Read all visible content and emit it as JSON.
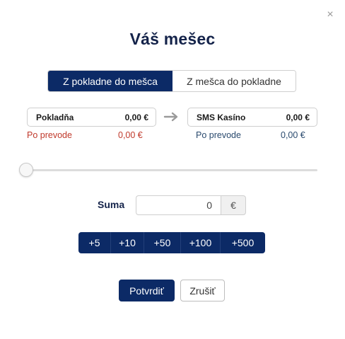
{
  "modal": {
    "title": "Váš mešec",
    "close_icon": "close-icon",
    "close_glyph": "×"
  },
  "tabs": [
    {
      "label": "Z pokladne do mešca",
      "active": true
    },
    {
      "label": "Z mešca do pokladne",
      "active": false
    }
  ],
  "source": {
    "name": "Pokladňa",
    "amount": "0,00 €",
    "after_label": "Po prevode",
    "after_amount": "0,00 €"
  },
  "target": {
    "name": "SMS Kasíno",
    "amount": "0,00 €",
    "after_label": "Po prevode",
    "after_amount": "0,00 €"
  },
  "arrow_icon": "arrow-right-icon",
  "slider": {
    "value_fraction": 0.0
  },
  "amount": {
    "label": "Suma",
    "value": "0",
    "currency": "€"
  },
  "quick_add": [
    "+5",
    "+10",
    "+50",
    "+100",
    "+500"
  ],
  "actions": {
    "confirm": "Potvrdiť",
    "cancel": "Zrušiť"
  },
  "colors": {
    "primary": "#0c2a66",
    "negative": "#c0392b",
    "neutral_text": "#2a4a6e"
  }
}
